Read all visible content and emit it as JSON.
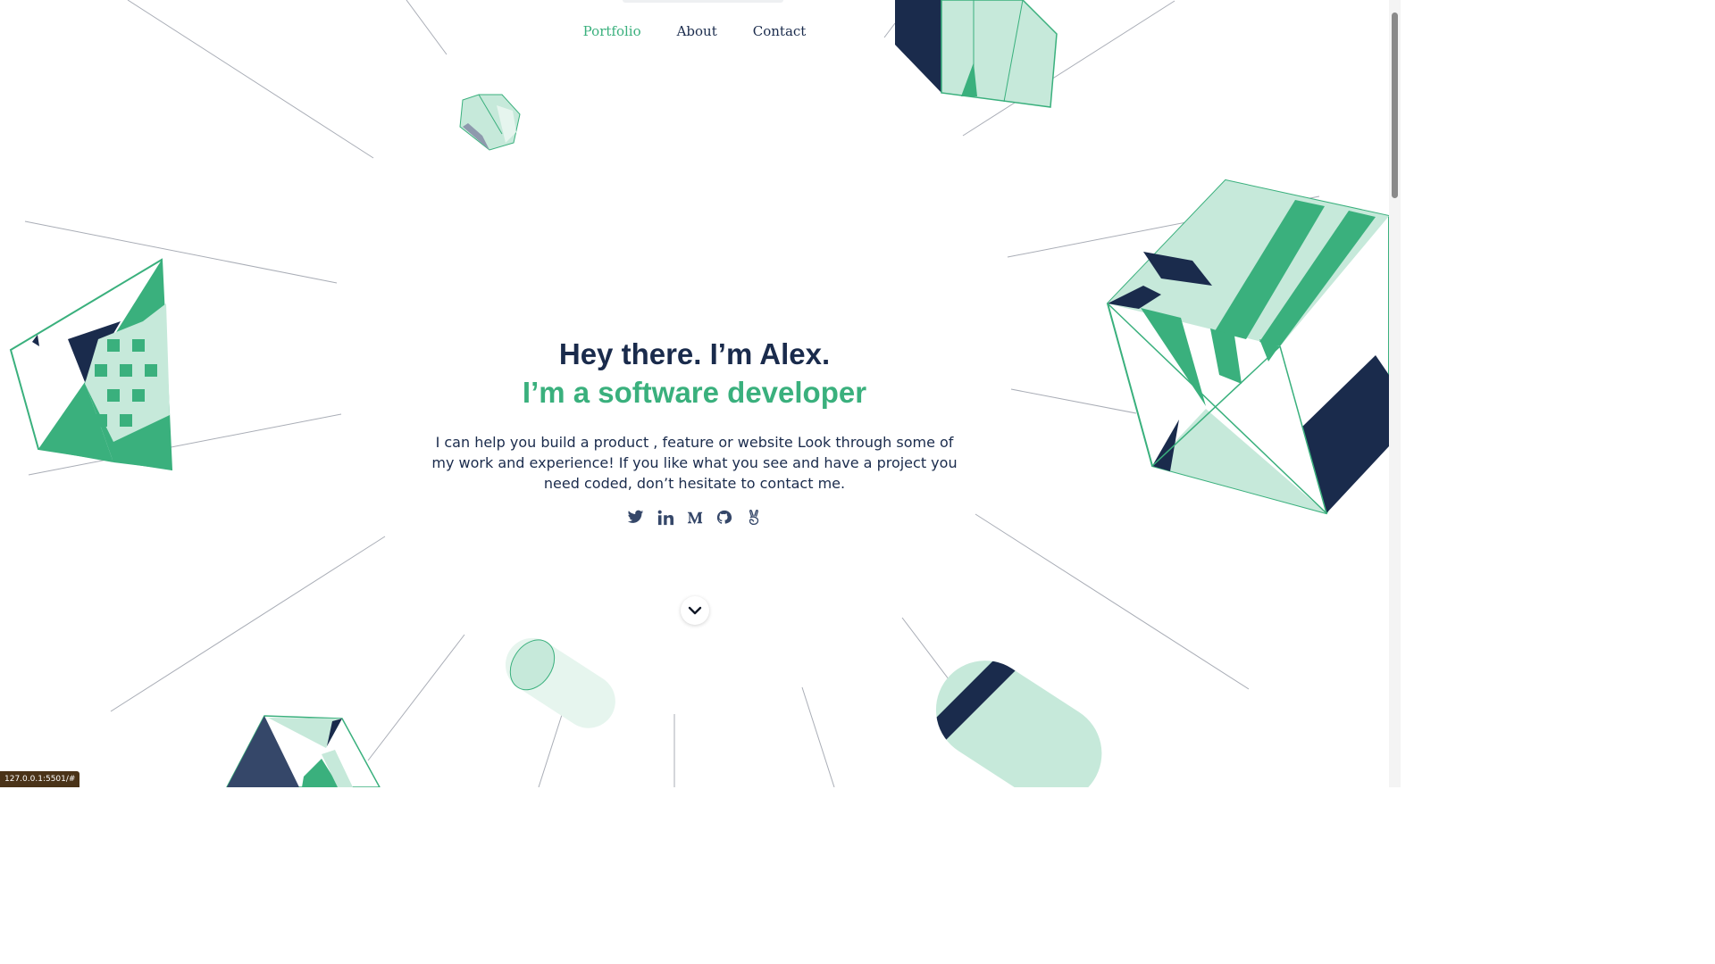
{
  "nav": {
    "items": [
      {
        "label": "Portfolio",
        "active": true
      },
      {
        "label": "About",
        "active": false
      },
      {
        "label": "Contact",
        "active": false
      }
    ]
  },
  "hero": {
    "greeting": "Hey there. I’m Alex.",
    "role": "I’m a software developer",
    "description": "I can help you build a product , feature or website Look through some of my work and experience! If you like what you see and have a project you need coded, don’t hesitate to contact me."
  },
  "social": [
    {
      "icon": "twitter-icon"
    },
    {
      "icon": "linkedin-icon"
    },
    {
      "icon": "medium-icon"
    },
    {
      "icon": "github-icon"
    },
    {
      "icon": "angellist-icon"
    }
  ],
  "scroll_button": {
    "icon": "chevron-down-icon"
  },
  "status_bar": {
    "url": "127.0.0.1:5501/#"
  },
  "colors": {
    "navy": "#1a2b4c",
    "green": "#3ab07d",
    "mint": "#c6e9da",
    "gray_blue": "#8e99ad"
  }
}
